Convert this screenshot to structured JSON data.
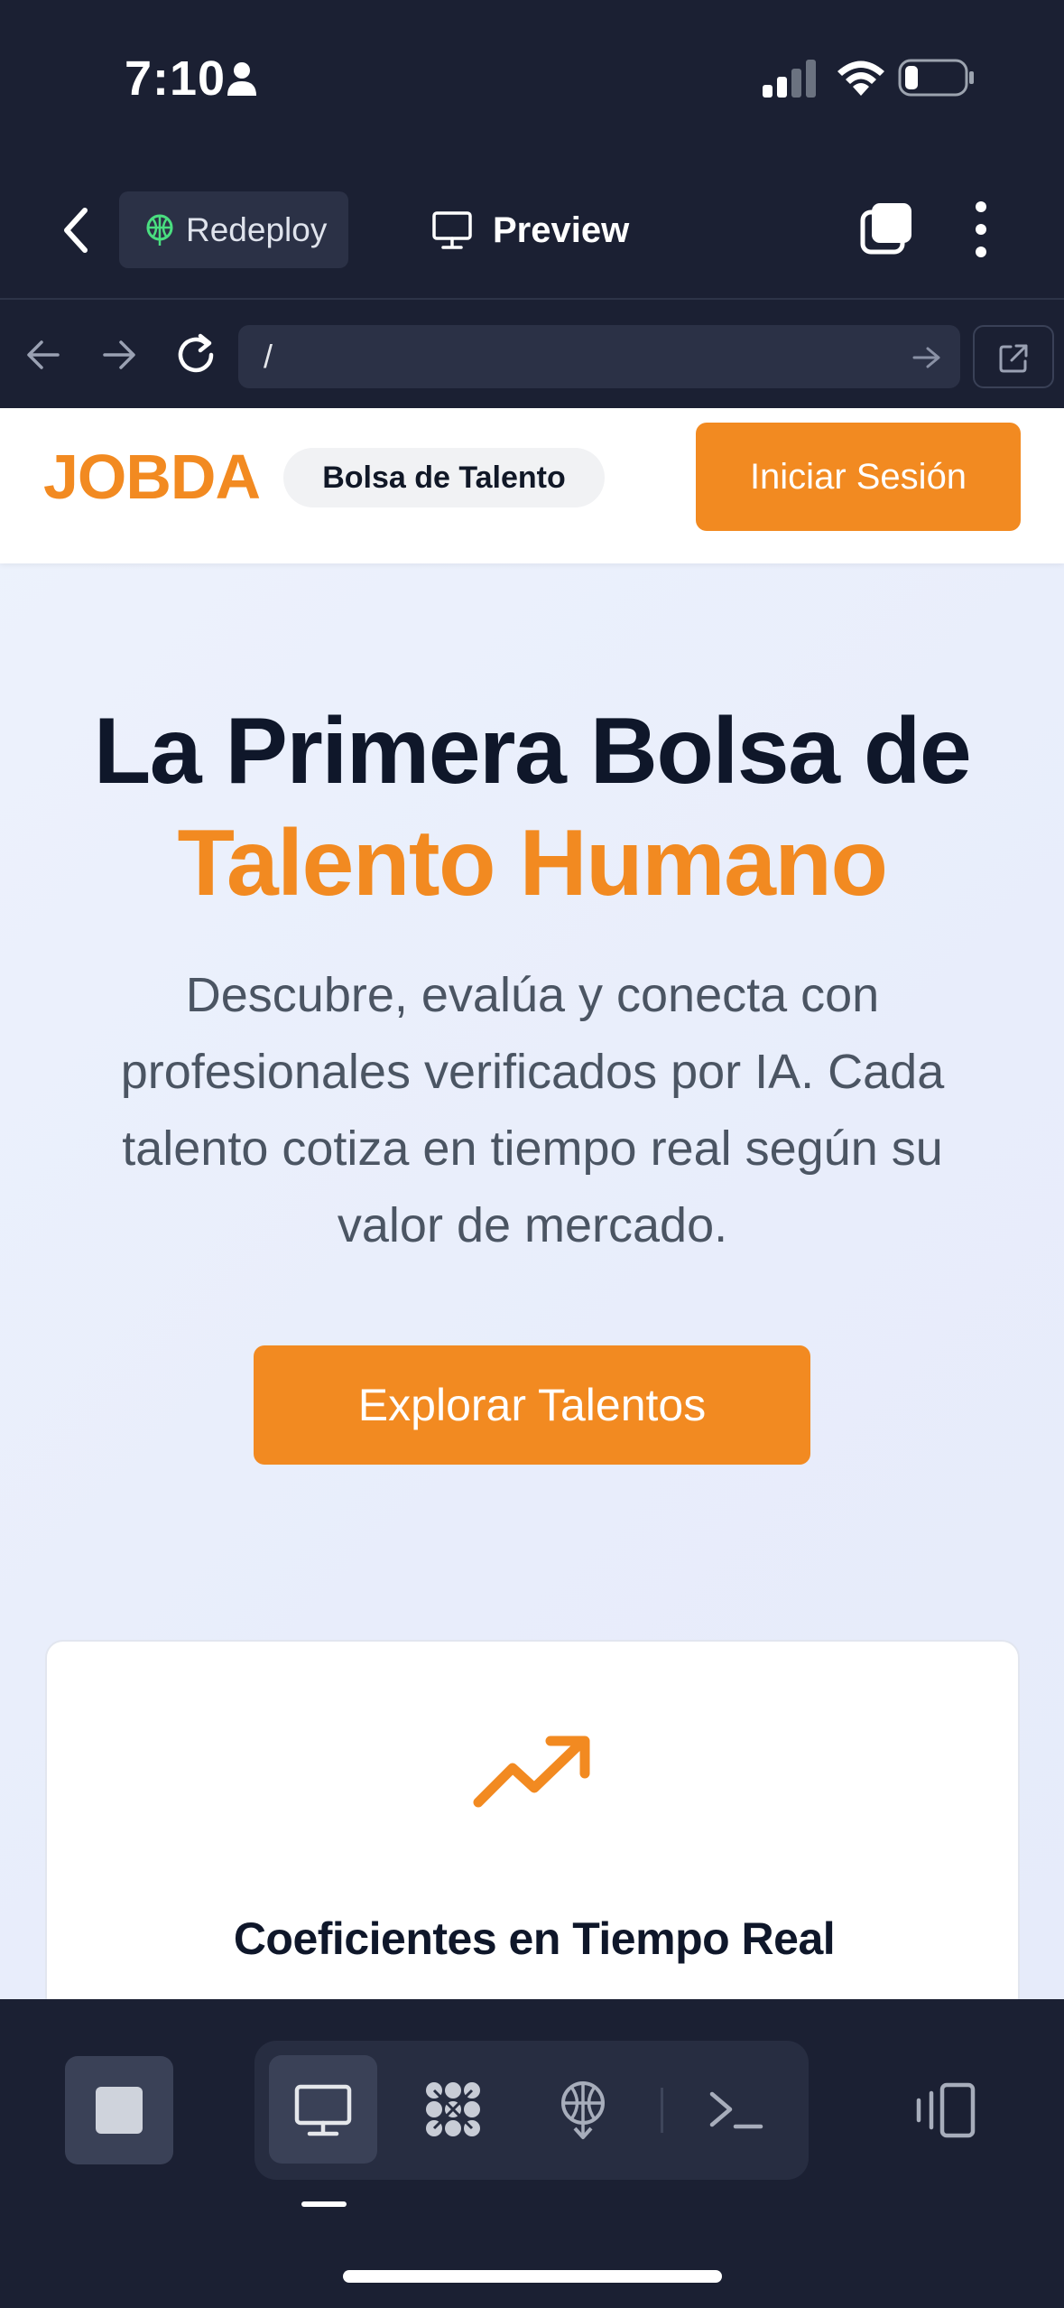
{
  "status_bar": {
    "time": "7:10"
  },
  "top_bar": {
    "redeploy_label": "Redeploy",
    "preview_label": "Preview"
  },
  "url_bar": {
    "path": "/"
  },
  "site": {
    "logo": "JOBDA",
    "badge": "Bolsa de Talento",
    "login_label": "Iniciar Sesión",
    "hero_title_line1": "La Primera Bolsa de",
    "hero_title_line2": "Talento Humano",
    "hero_subtitle": "Descubre, evalúa y conecta con profesionales verificados por IA. Cada talento cotiza en tiempo real según su valor de mercado.",
    "cta_label": "Explorar Talentos",
    "feature_title": "Coeficientes en Tiempo Real"
  },
  "colors": {
    "accent": "#f28a21",
    "app_chrome": "#1b2033",
    "heading": "#0f172a"
  },
  "icons": {
    "status": [
      "person-icon",
      "signal-icon",
      "wifi-icon",
      "battery-icon"
    ],
    "top_bar": [
      "back-chevron-icon",
      "rocket-icon",
      "monitor-icon",
      "windows-icon",
      "kebab-icon"
    ],
    "url_bar": [
      "arrow-left-icon",
      "arrow-right-icon",
      "reload-icon",
      "arrow-go-icon",
      "external-link-icon"
    ],
    "feature": [
      "trending-up-icon"
    ],
    "bottom_bar": [
      "stop-icon",
      "monitor-icon",
      "workflow-icon",
      "deploy-icon",
      "terminal-icon",
      "devices-icon"
    ]
  }
}
